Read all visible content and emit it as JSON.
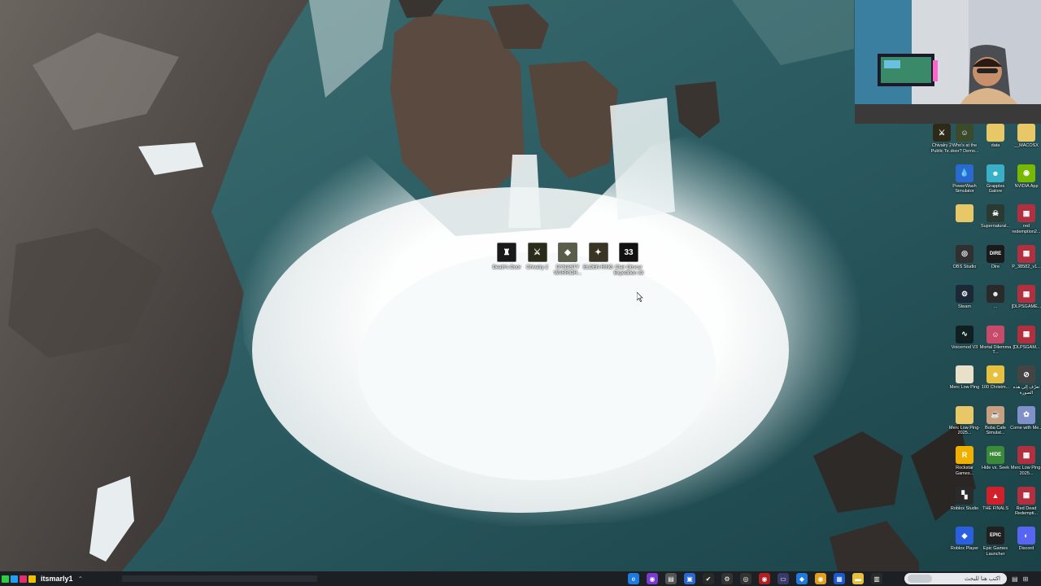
{
  "center_icons": [
    {
      "label": "Death's Door",
      "color": "#1a1a1a",
      "glyph": "♜"
    },
    {
      "label": "Chivalry 2",
      "color": "#2b2b1a",
      "glyph": "⚔"
    },
    {
      "label": "DYNASTY WARRIOR...",
      "color": "#5a5d48",
      "glyph": "◆"
    },
    {
      "label": "ELDEN RING",
      "color": "#3a3422",
      "glyph": "✦"
    },
    {
      "label": "Clair Obscur Expedition 33",
      "color": "#111111",
      "glyph": "33"
    }
  ],
  "right_icons": [
    {
      "label": "Chivalry 2 Public Te...",
      "color": "#2e2a1a",
      "glyph": "⚔"
    },
    {
      "label": "Who's at the door? Demo...",
      "color": "#3a4a2a",
      "glyph": "☺"
    },
    {
      "label": "data",
      "color": "#e8c866",
      "glyph": ""
    },
    {
      "label": "__MACOSX",
      "color": "#e8c866",
      "glyph": ""
    },
    {
      "label": "PowerWash Simulator",
      "color": "#2a6ad0",
      "glyph": "💧"
    },
    {
      "label": "Grapples Galore",
      "color": "#3ab0c8",
      "glyph": "☻"
    },
    {
      "label": "NVIDIA App",
      "color": "#76b900",
      "glyph": "◉"
    },
    {
      "label": "",
      "color": "#e8c866",
      "glyph": ""
    },
    {
      "label": "Supernatural...",
      "color": "#2a3a30",
      "glyph": "☠"
    },
    {
      "label": "red redemption2...",
      "color": "#b03040",
      "glyph": "▦"
    },
    {
      "label": "OBS Studio",
      "color": "#303030",
      "glyph": "◎"
    },
    {
      "label": "Dire",
      "color": "#1a1a1a",
      "glyph": "DIRE"
    },
    {
      "label": "P_38582_v1...",
      "color": "#b03040",
      "glyph": "▦"
    },
    {
      "label": "Steam",
      "color": "#1b2838",
      "glyph": "⚙"
    },
    {
      "label": "...",
      "color": "#2a2a2a",
      "glyph": "☻"
    },
    {
      "label": "[DLPSGAME...",
      "color": "#b03040",
      "glyph": "▦"
    },
    {
      "label": "Voicemod V3",
      "color": "#102020",
      "glyph": "∿"
    },
    {
      "label": "Mortal Dilemma T...",
      "color": "#c84a6a",
      "glyph": "☺"
    },
    {
      "label": "[DLPSGAM...",
      "color": "#b03040",
      "glyph": "▦"
    },
    {
      "label": "Merc Low Ping",
      "color": "#e8e0c8",
      "glyph": ""
    },
    {
      "label": "100 Christm...",
      "color": "#e8c040",
      "glyph": "☻"
    },
    {
      "label": "تعرّف إلى هذه الصورة",
      "color": "#444444",
      "glyph": "⊘"
    },
    {
      "label": "Merc Low Ping-2025...",
      "color": "#e8c866",
      "glyph": ""
    },
    {
      "label": "Boba Cafe Simulat...",
      "color": "#c8a080",
      "glyph": "☕"
    },
    {
      "label": "Come with Me...",
      "color": "#8090c8",
      "glyph": "✿"
    },
    {
      "label": "Rockstar Games...",
      "color": "#f0b000",
      "glyph": "R"
    },
    {
      "label": "Hide vs. Seek",
      "color": "#3a8a3a",
      "glyph": "HIDE"
    },
    {
      "label": "Merc Low Ping-2025...",
      "color": "#b03040",
      "glyph": "▦"
    },
    {
      "label": "Roblox Studio",
      "color": "#2a2a2a",
      "glyph": "▚"
    },
    {
      "label": "THE FINALS",
      "color": "#d0202a",
      "glyph": "▲"
    },
    {
      "label": "Red Dead Redempti...",
      "color": "#b03040",
      "glyph": "▦"
    },
    {
      "label": "Roblox Player",
      "color": "#2a60e0",
      "glyph": "◆"
    },
    {
      "label": "Epic Games Launcher",
      "color": "#202020",
      "glyph": "EPIC"
    },
    {
      "label": "Discord",
      "color": "#5865f2",
      "glyph": "◐"
    }
  ],
  "taskbar": {
    "streamer_name": "itsmarly1",
    "search_placeholder": "اكتب هنا للبحث",
    "apps": [
      {
        "name": "edge-icon",
        "color": "#1f7ae0",
        "glyph": "e"
      },
      {
        "name": "app-icon-2",
        "color": "#7a3ad0",
        "glyph": "◉"
      },
      {
        "name": "app-icon-3",
        "color": "#555555",
        "glyph": "▤"
      },
      {
        "name": "app-icon-4",
        "color": "#2a6ad0",
        "glyph": "▣"
      },
      {
        "name": "app-icon-5",
        "color": "#2a2a2a",
        "glyph": "✔"
      },
      {
        "name": "settings-icon",
        "color": "#333333",
        "glyph": "⚙"
      },
      {
        "name": "app-icon-7",
        "color": "#333333",
        "glyph": "◎"
      },
      {
        "name": "app-icon-8",
        "color": "#b02020",
        "glyph": "◉"
      },
      {
        "name": "app-icon-9",
        "color": "#3a3a6a",
        "glyph": "▭"
      },
      {
        "name": "app-icon-10",
        "color": "#1f7ae0",
        "glyph": "◆"
      },
      {
        "name": "chrome-icon",
        "color": "#e0a020",
        "glyph": "◉"
      },
      {
        "name": "app-icon-12",
        "color": "#1b5ad0",
        "glyph": "▦"
      },
      {
        "name": "folder-icon",
        "color": "#e8c040",
        "glyph": "▬"
      },
      {
        "name": "app-icon-14",
        "color": "#2a2a2a",
        "glyph": "▥"
      }
    ]
  }
}
